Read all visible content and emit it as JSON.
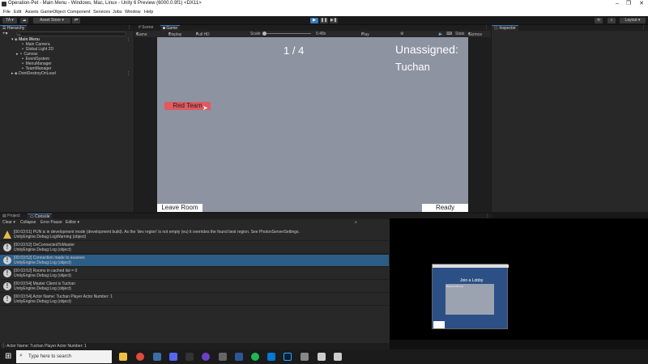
{
  "window": {
    "title": "Operation-Pet - Main Menu - Windows, Mac, Linux - Unity 6 Preview (6000.0.9f1) <DX11>",
    "controls": [
      "–",
      "❐",
      "✕"
    ]
  },
  "menu": [
    "File",
    "Edit",
    "Assets",
    "GameObject",
    "Component",
    "Services",
    "Jobs",
    "Window",
    "Help"
  ],
  "toolbar": {
    "account": "TA",
    "asset_store": "Asset Store",
    "layout": "Layout"
  },
  "hierarchy": {
    "tab": "Hierarchy",
    "search_placeholder": "All",
    "items": [
      {
        "label": "Main Menu",
        "indent": 0
      },
      {
        "label": "Main Camera",
        "indent": 1
      },
      {
        "label": "Global Light 2D",
        "indent": 1
      },
      {
        "label": "Canvas",
        "indent": 1
      },
      {
        "label": "EventSystem",
        "indent": 1
      },
      {
        "label": "MenuManager",
        "indent": 1
      },
      {
        "label": "TeamManager",
        "indent": 1
      },
      {
        "label": "DontDestroyOnLoad",
        "indent": 0
      }
    ]
  },
  "center_tabs": {
    "scene": "Scene",
    "game": "Game"
  },
  "game_toolbar": {
    "mode": "Game",
    "display": "Display 1",
    "resolution": "Full HD (1920x1080)",
    "scale_label": "Scale",
    "scale_value": "0.48x",
    "play_focused": "Play Focused",
    "stats": "Stats",
    "gizmos": "Gizmos"
  },
  "game": {
    "counter": "1 / 4",
    "unassigned_label": "Unassigned:",
    "player_name": "Tuchan",
    "red_team_button": "Red Team",
    "leave_room_button": "Leave Room",
    "ready_button": "Ready",
    "bg_color": "#8d93a1",
    "red_color": "#e05a5f"
  },
  "inspector": {
    "tab": "Inspector"
  },
  "console": {
    "tabs": {
      "project": "Project",
      "console": "Console"
    },
    "controls": {
      "clear": "Clear",
      "collapse": "Collapse",
      "error_pause": "Error Pause",
      "editor": "Editor"
    },
    "entries": [
      {
        "type": "warn",
        "line1": "[00:03:51] PUN is in development mode (development build). As the 'dev region' is not empty (eu) it overrides the found best region. See PhotonServerSettings.",
        "line2": "UnityEngine.Debug:LogWarning (object)"
      },
      {
        "type": "info",
        "line1": "[00:03:52] OnConnectedToMaster",
        "line2": "UnityEngine.Debug:Log (object)"
      },
      {
        "type": "info",
        "line1": "[00:03:52] Connection made to eusever.",
        "line2": "UnityEngine.Debug:Log (object)",
        "selected": true
      },
      {
        "type": "info",
        "line1": "[00:03:52] Rooms in cached list = 0",
        "line2": "UnityEngine.Debug:Log (object)"
      },
      {
        "type": "info",
        "line1": "[00:03:54] Master Client is Tuchan",
        "line2": "UnityEngine.Debug:Log (object)"
      },
      {
        "type": "info",
        "line1": "[00:03:54] Actor Name: Tuchan Player Actor Number: 1",
        "line2": "UnityEngine.Debug:Log (object)"
      }
    ],
    "status_bar": "Actor Name: Tuchan Player Actor Number: 1"
  },
  "overlay_game": {
    "title": "Join a Lobby",
    "list_header": "Refresh Rooms"
  },
  "taskbar": {
    "search_placeholder": "Type here to search"
  }
}
